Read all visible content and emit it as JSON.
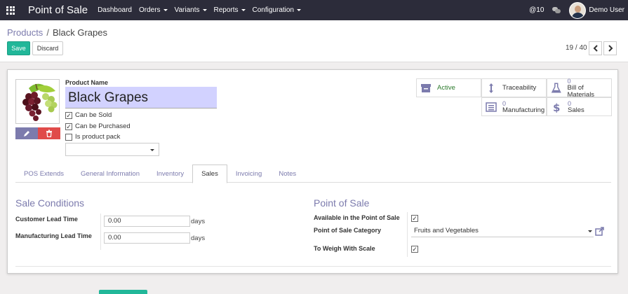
{
  "navbar": {
    "app_title": "Point of Sale",
    "menu": [
      {
        "label": "Dashboard",
        "dropdown": false
      },
      {
        "label": "Orders",
        "dropdown": true
      },
      {
        "label": "Variants",
        "dropdown": true
      },
      {
        "label": "Reports",
        "dropdown": true
      },
      {
        "label": "Configuration",
        "dropdown": true
      }
    ],
    "activity_label": "@10",
    "user": "Demo User",
    "background": "#2c2c3a"
  },
  "breadcrumb": {
    "parent": "Products",
    "separator": "/",
    "current": "Black Grapes"
  },
  "buttons": {
    "save": "Save",
    "discard": "Discard"
  },
  "pager": {
    "value": "19 / 40",
    "prev_icon": "chevron-left-icon",
    "next_icon": "chevron-right-icon"
  },
  "product": {
    "name_label": "Product Name",
    "name": "Black Grapes",
    "image_icon": "grapes-image",
    "checkboxes": [
      {
        "label": "Can be Sold",
        "checked": true
      },
      {
        "label": "Can be Purchased",
        "checked": true
      },
      {
        "label": "Is product pack",
        "checked": false
      }
    ],
    "select_value": ""
  },
  "smart_buttons": {
    "active": {
      "label": "Active",
      "icon": "archive-icon"
    },
    "traceability": {
      "label": "Traceability",
      "icon": "arrows-vertical-icon"
    },
    "bom": {
      "count": "0",
      "label": "Bill of Materials",
      "icon": "flask-icon"
    },
    "manufacturing": {
      "count": "0",
      "label": "Manufacturing",
      "icon": "list-alt-icon"
    },
    "sales": {
      "count": "0",
      "label": "Sales",
      "icon": "dollar-icon"
    }
  },
  "tabs": [
    {
      "label": "POS Extends",
      "active": false
    },
    {
      "label": "General Information",
      "active": false
    },
    {
      "label": "Inventory",
      "active": false
    },
    {
      "label": "Sales",
      "active": true
    },
    {
      "label": "Invoicing",
      "active": false
    },
    {
      "label": "Notes",
      "active": false
    }
  ],
  "sale_conditions": {
    "title": "Sale Conditions",
    "customer_lead_label": "Customer Lead Time",
    "customer_lead_value": "0.00",
    "manufacturing_lead_label": "Manufacturing Lead Time",
    "manufacturing_lead_value": "0.00",
    "unit": "days"
  },
  "point_of_sale": {
    "title": "Point of Sale",
    "available_label": "Available in the Point of Sale",
    "available_checked": true,
    "category_label": "Point of Sale Category",
    "category_value": "Fruits and Vegetables",
    "weigh_label": "To Weigh With Scale",
    "weigh_checked": true
  },
  "colors": {
    "primary": "#7c7bad",
    "save": "#21b799",
    "delete": "#e04b4a",
    "name_bg": "#d2d2ff",
    "active_text": "#2c7a2c"
  }
}
